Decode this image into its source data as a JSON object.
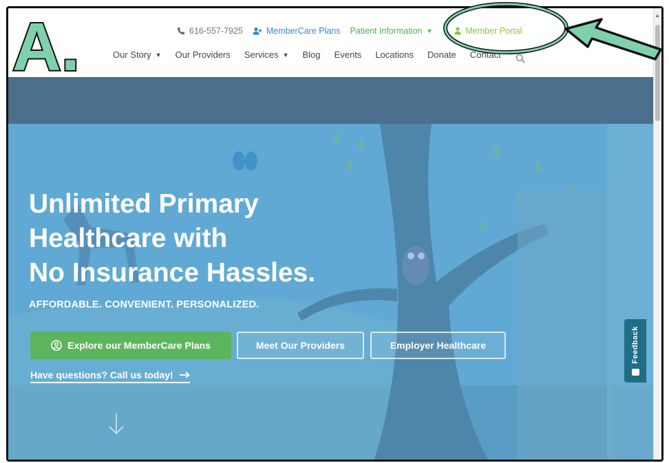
{
  "annotation": {
    "letter": "A.",
    "colors": {
      "fill": "#7fd1ae",
      "stroke": "#111111"
    }
  },
  "topbar": {
    "phone": {
      "icon": "phone-icon",
      "label": "616-557-7925"
    },
    "membercare_plans": {
      "icon": "user-plus-icon",
      "label": "MemberCare Plans"
    },
    "patient_information": {
      "label": "Patient Information",
      "icon": "chevron-down-icon"
    },
    "member_portal": {
      "icon": "person-icon",
      "label": "Member Portal"
    }
  },
  "nav": {
    "items": [
      {
        "label": "Our Story",
        "has_dropdown": true
      },
      {
        "label": "Our Providers",
        "has_dropdown": false
      },
      {
        "label": "Services",
        "has_dropdown": true
      },
      {
        "label": "Blog",
        "has_dropdown": false
      },
      {
        "label": "Events",
        "has_dropdown": false
      },
      {
        "label": "Locations",
        "has_dropdown": false
      },
      {
        "label": "Donate",
        "has_dropdown": false
      },
      {
        "label": "Contact",
        "has_dropdown": false
      }
    ],
    "search_icon": "search-icon"
  },
  "hero": {
    "title_lines": [
      "Unlimited Primary",
      "Healthcare with",
      "No Insurance Hassles."
    ],
    "subtitle": "AFFORDABLE. CONVENIENT. PERSONALIZED.",
    "buttons": {
      "explore": {
        "icon": "user-circle-icon",
        "label": "Explore our MemberCare Plans"
      },
      "providers": {
        "label": "Meet Our Providers"
      },
      "employer": {
        "label": "Employer Healthcare"
      }
    },
    "call_link": {
      "label": "Have questions? Call us today!",
      "icon": "arrow-right-icon"
    },
    "scroll_icon": "arrow-down-icon"
  },
  "feedback": {
    "label": "Feedback",
    "icon": "feedback-icon"
  },
  "colors": {
    "accent_green": "#5cb55d",
    "link_blue": "#3b86c8",
    "portal_green": "#8cc63f",
    "hero_blue": "#5fa9d4",
    "band": "#4b6f8c",
    "feedback_teal": "#1f6d86"
  }
}
